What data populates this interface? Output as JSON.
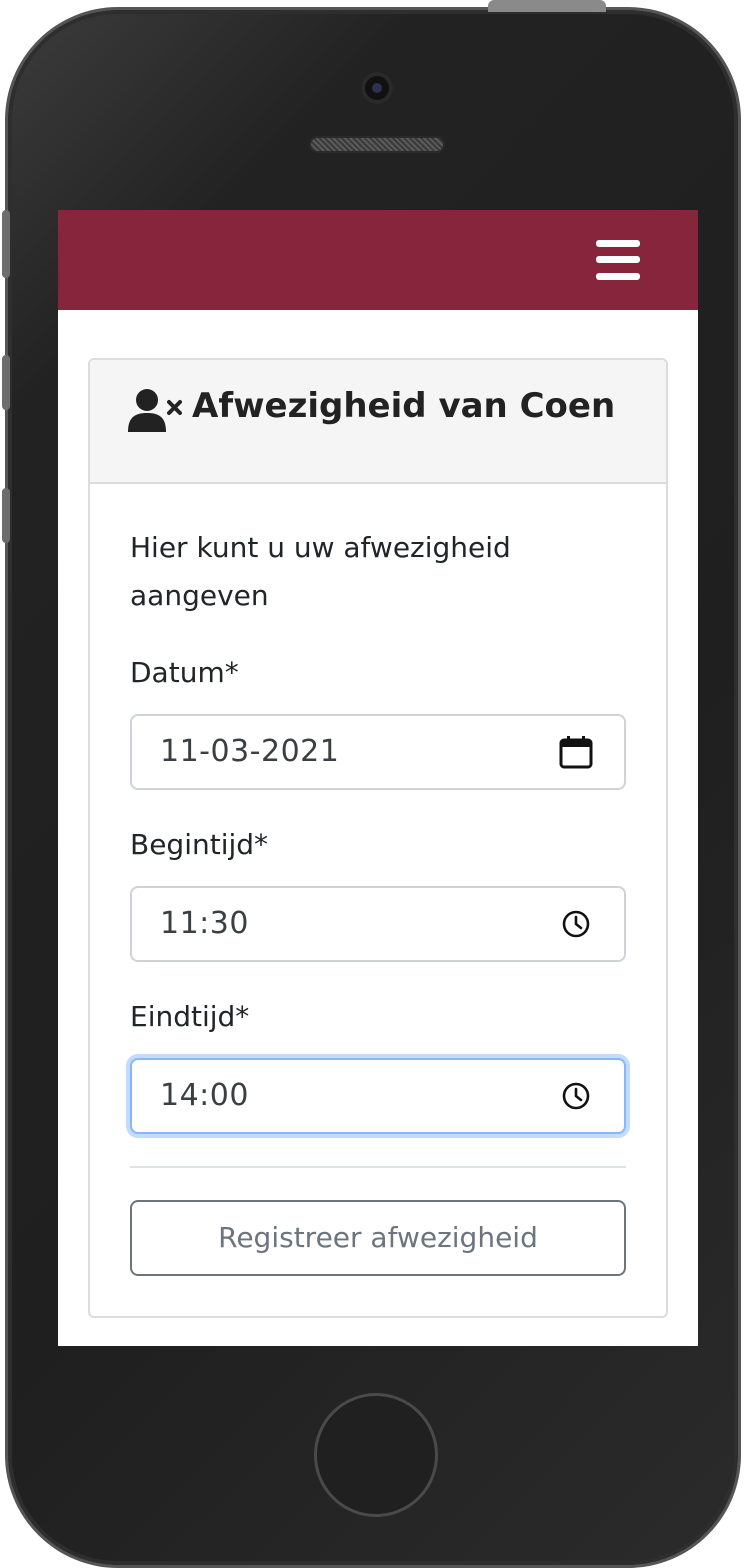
{
  "navbar": {
    "color": "#86253b",
    "menu_icon": "hamburger-menu-icon"
  },
  "card": {
    "header_icon": "user-remove-icon",
    "title": "Afwezigheid van Coen",
    "intro": "Hier kunt u uw afwezigheid aangeven"
  },
  "form": {
    "date": {
      "label": "Datum*",
      "value": "11-03-2021",
      "icon": "calendar-icon"
    },
    "start": {
      "label": "Begintijd*",
      "value": "11:30",
      "icon": "clock-icon"
    },
    "end": {
      "label": "Eindtijd*",
      "value": "14:00",
      "icon": "clock-icon"
    },
    "submit_label": "Registreer afwezigheid"
  }
}
